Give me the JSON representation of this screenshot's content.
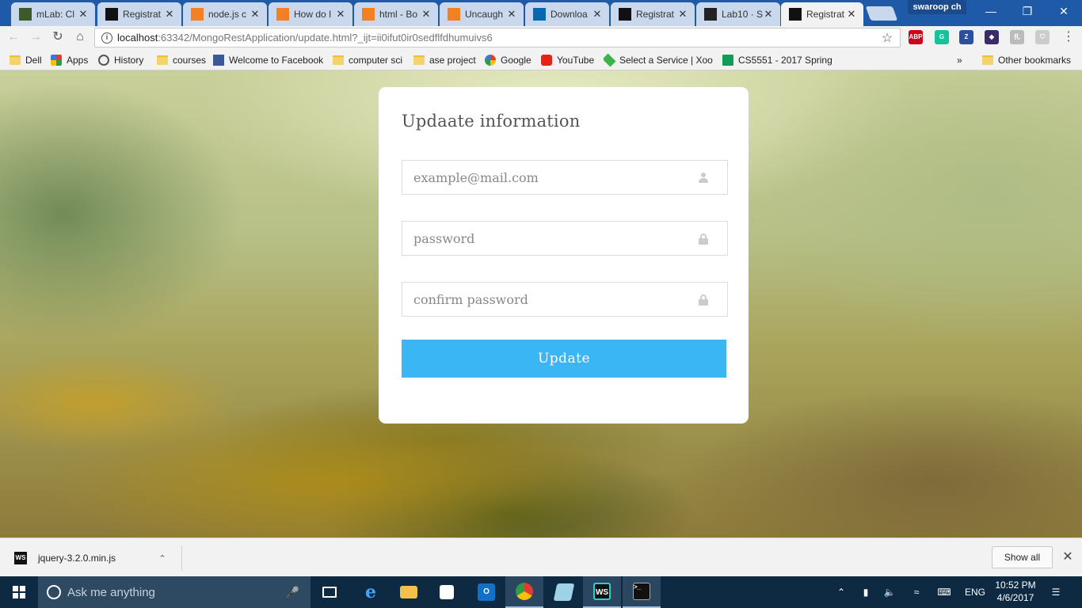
{
  "browser": {
    "tabs": [
      {
        "title": "mLab: Cl",
        "icon": "mlab-icon",
        "color": "#3d5a2a"
      },
      {
        "title": "Registrat",
        "icon": "webstorm-icon",
        "color": "#111111"
      },
      {
        "title": "node.js c",
        "icon": "stackoverflow-icon",
        "color": "#f48024"
      },
      {
        "title": "How do I",
        "icon": "stackoverflow-icon",
        "color": "#f48024"
      },
      {
        "title": "html - Bo",
        "icon": "stackoverflow-icon",
        "color": "#f48024"
      },
      {
        "title": "Uncaugh",
        "icon": "stackoverflow-icon",
        "color": "#f48024"
      },
      {
        "title": "Downloa",
        "icon": "jquery-icon",
        "color": "#0769ad"
      },
      {
        "title": "Registrat",
        "icon": "webstorm-icon",
        "color": "#111111"
      },
      {
        "title": "Lab10 · S",
        "icon": "github-icon",
        "color": "#222222"
      },
      {
        "title": "Registrat",
        "icon": "webstorm-icon",
        "color": "#111111",
        "active": true
      }
    ],
    "profile_name": "swaroop ch",
    "window_controls": {
      "minimize": "—",
      "restore": "❐",
      "close": "✕"
    },
    "url_host": "localhost",
    "url_rest": ":63342/MongoRestApplication/update.html?_ijt=ii0ifut0ir0sedflfdhumuivs6",
    "extensions": [
      {
        "name": "adblock-icon",
        "label": "ABP",
        "color": "#d0021b"
      },
      {
        "name": "grammarly-icon",
        "label": "G",
        "color": "#15c39a"
      },
      {
        "name": "zotero-icon",
        "label": "Z",
        "color": "#2a4ea0"
      },
      {
        "name": "extension-icon",
        "label": "◆",
        "color": "#3a2a6a"
      },
      {
        "name": "translate-icon",
        "label": "扎",
        "color": "#bbbbbb"
      },
      {
        "name": "shield-icon",
        "label": "⛉",
        "color": "#cccccc"
      }
    ]
  },
  "bookmarks": {
    "items": [
      {
        "label": "Dell",
        "icon": "folder"
      },
      {
        "label": "Apps",
        "icon": "apps"
      },
      {
        "label": "History",
        "icon": "history"
      },
      {
        "label": "courses",
        "icon": "folder"
      },
      {
        "label": "Welcome to Facebook",
        "icon": "facebook"
      },
      {
        "label": "computer sci",
        "icon": "folder"
      },
      {
        "label": "ase project",
        "icon": "folder"
      },
      {
        "label": "Google",
        "icon": "google"
      },
      {
        "label": "YouTube",
        "icon": "youtube"
      },
      {
        "label": "Select a Service | Xoom",
        "icon": "xoom"
      },
      {
        "label": "CS5551 - 2017 Spring",
        "icon": "sheets"
      }
    ],
    "overflow": "»",
    "other": "Other bookmarks"
  },
  "form": {
    "title": "Updaate information",
    "email_placeholder": "example@mail.com",
    "password_placeholder": "password",
    "confirm_placeholder": "confirm password",
    "submit_label": "Update"
  },
  "downloads": {
    "file_name": "jquery-3.2.0.min.js",
    "file_icon": "WS",
    "show_all": "Show all"
  },
  "taskbar": {
    "search_placeholder": "Ask me anything",
    "language": "ENG",
    "time": "10:52 PM",
    "date": "4/6/2017"
  }
}
